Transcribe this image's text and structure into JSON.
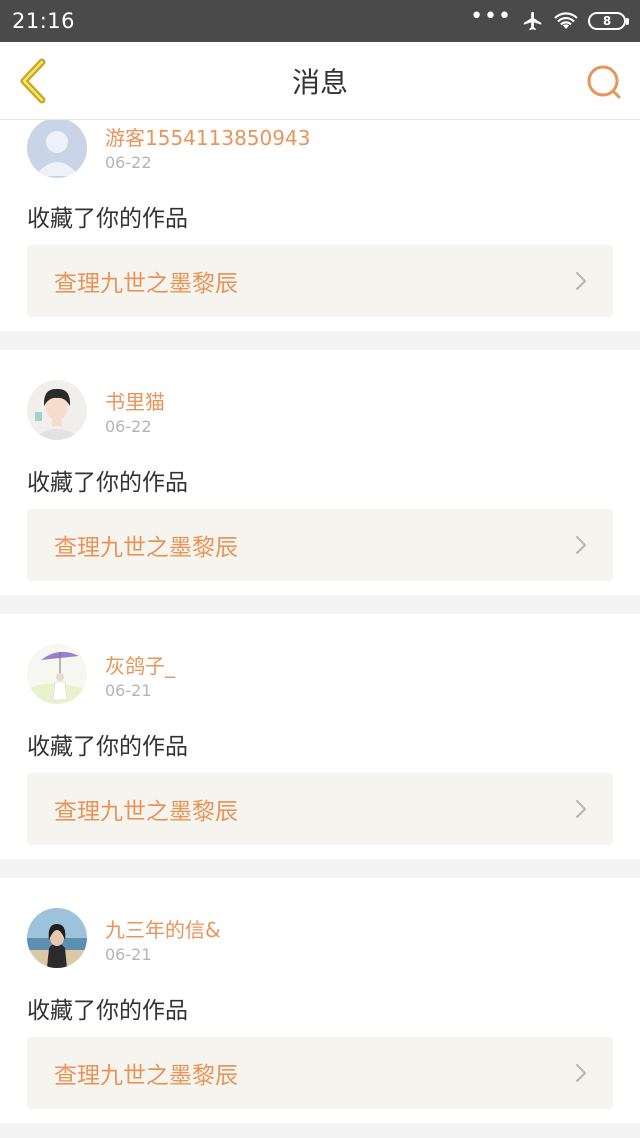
{
  "status_bar": {
    "time": "21:16",
    "more": "•••",
    "battery": "8"
  },
  "nav": {
    "title": "消息",
    "back_icon": "chevron-left-icon",
    "search_icon": "search-icon",
    "accent": "#e8955a",
    "back_color": "#c8a814"
  },
  "messages": [
    {
      "user": "游客1554113850943",
      "date": "06-22",
      "action": "收藏了你的作品",
      "work": "查理九世之墨黎辰",
      "avatar": "default-avatar"
    },
    {
      "user": "书里猫",
      "date": "06-22",
      "action": "收藏了你的作品",
      "work": "查理九世之墨黎辰",
      "avatar": "anime-boy-avatar"
    },
    {
      "user": "灰鸽子_",
      "date": "06-21",
      "action": "收藏了你的作品",
      "work": "查理九世之墨黎辰",
      "avatar": "umbrella-girl-avatar"
    },
    {
      "user": "九三年的信&",
      "date": "06-21",
      "action": "收藏了你的作品",
      "work": "查理九世之墨黎辰",
      "avatar": "beach-girl-avatar"
    }
  ]
}
